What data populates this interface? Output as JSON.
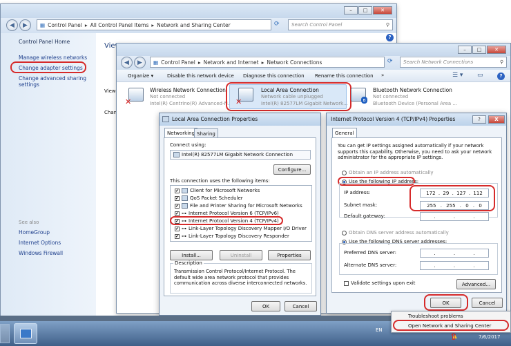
{
  "main_window": {
    "address": [
      "Control Panel",
      "All Control Panel Items",
      "Network and Sharing Center"
    ],
    "search_placeholder": "Search Control Panel",
    "sidebar": {
      "home": "Control Panel Home",
      "links": [
        "Manage wireless networks",
        "Change adapter settings",
        "Change advanced sharing settings"
      ],
      "see_also": "See also",
      "see_also_links": [
        "HomeGroup",
        "Internet Options",
        "Windows Firewall"
      ]
    },
    "partial_labels": [
      "View",
      "View",
      "Chan"
    ]
  },
  "net_conn_window": {
    "address": [
      "Control Panel",
      "Network and Internet",
      "Network Connections"
    ],
    "search_placeholder": "Search Network Connections",
    "toolbar": [
      "Organize ▾",
      "Disable this network device",
      "Diagnose this connection",
      "Rename this connection",
      "»"
    ],
    "adapters": [
      {
        "name": "Wireless Network Connection",
        "status": "Not connected",
        "device": "Intel(R) Centrino(R) Advanced-N..."
      },
      {
        "name": "Local Area Connection",
        "status": "Network cable unplugged",
        "device": "Intel(R) 82577LM Gigabit Network..."
      },
      {
        "name": "Bluetooth Network Connection",
        "status": "Not connected",
        "device": "Bluetooth Device (Personal Area ..."
      }
    ]
  },
  "lac_dialog": {
    "title": "Local Area Connection Properties",
    "tabs": [
      "Networking",
      "Sharing"
    ],
    "connect_using_label": "Connect using:",
    "adapter_name": "Intel(R) 82577LM Gigabit Network Connection",
    "configure_btn": "Configure...",
    "items_label": "This connection uses the following items:",
    "items": [
      "Client for Microsoft Networks",
      "QoS Packet Scheduler",
      "File and Printer Sharing for Microsoft Networks",
      "Internet Protocol Version 6 (TCP/IPv6)",
      "Internet Protocol Version 4 (TCP/IPv4)",
      "Link-Layer Topology Discovery Mapper I/O Driver",
      "Link-Layer Topology Discovery Responder"
    ],
    "install_btn": "Install...",
    "uninstall_btn": "Uninstall",
    "properties_btn": "Properties",
    "description_label": "Description",
    "description_text": "Transmission Control Protocol/Internet Protocol. The default wide area network protocol that provides communication across diverse interconnected networks.",
    "ok_btn": "OK",
    "cancel_btn": "Cancel"
  },
  "ipv4_dialog": {
    "title": "Internet Protocol Version 4 (TCP/IPv4) Properties",
    "help_btn": "?",
    "close_btn": "X",
    "tab": "General",
    "intro": "You can get IP settings assigned automatically if your network supports this capability. Otherwise, you need to ask your network administrator for the appropriate IP settings.",
    "auto_ip": "Obtain an IP address automatically",
    "use_ip": "Use the following IP address:",
    "ip_label": "IP address:",
    "ip_value": [
      "172",
      "29",
      "127",
      "112"
    ],
    "mask_label": "Subnet mask:",
    "mask_value": [
      "255",
      "255",
      "0",
      "0"
    ],
    "gateway_label": "Default gateway:",
    "auto_dns": "Obtain DNS server address automatically",
    "use_dns": "Use the following DNS server addresses:",
    "pref_dns_label": "Preferred DNS server:",
    "alt_dns_label": "Alternate DNS server:",
    "validate_label": "Validate settings upon exit",
    "advanced_btn": "Advanced...",
    "ok_btn": "OK",
    "cancel_btn": "Cancel"
  },
  "tray_menu": {
    "items": [
      "Troubleshoot problems",
      "Open Network and Sharing Center"
    ]
  },
  "taskbar": {
    "lang": "EN",
    "date": "7/6/2017"
  },
  "colors": {
    "highlight": "#d62a2a",
    "link": "#1e3f8c",
    "desktop": "#5a6e86"
  }
}
